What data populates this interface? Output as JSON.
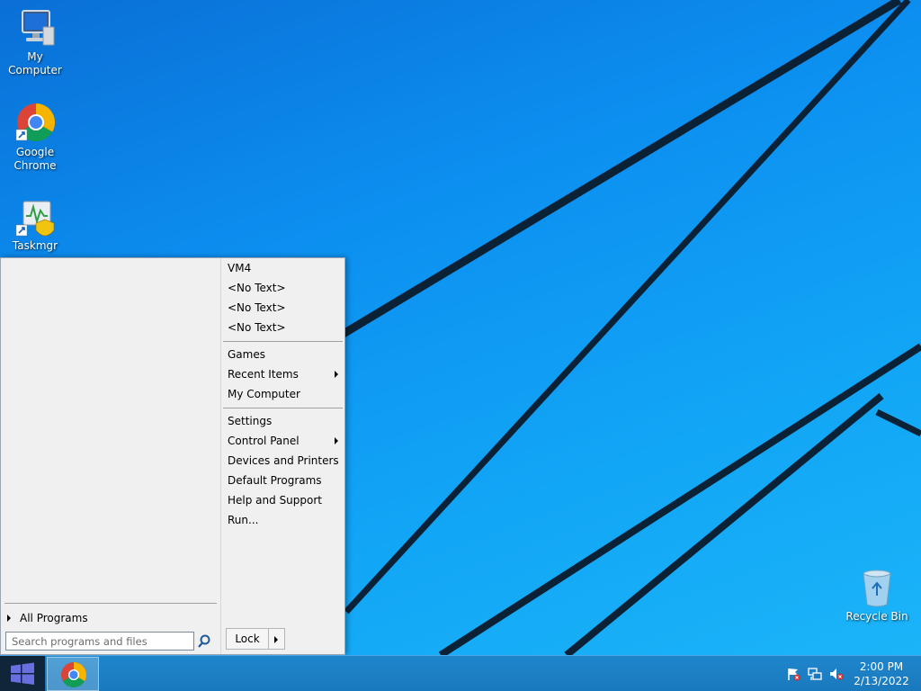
{
  "desktop": {
    "icons": [
      {
        "label": "My Computer",
        "icon": "computer-icon"
      },
      {
        "label": "Google Chrome",
        "icon": "chrome-icon"
      },
      {
        "label": "Taskmgr",
        "icon": "task-manager-icon"
      },
      {
        "label": "Recycle Bin",
        "icon": "recycle-bin-icon"
      }
    ]
  },
  "start_menu": {
    "all_programs_label": "All Programs",
    "search_placeholder": "Search programs and files",
    "right_items": [
      {
        "label": "VM4"
      },
      {
        "label": "<No Text>"
      },
      {
        "label": "<No Text>"
      },
      {
        "label": "<No Text>"
      },
      {
        "label": "Games"
      },
      {
        "label": "Recent Items",
        "submenu": true
      },
      {
        "label": "My Computer"
      },
      {
        "label": "Settings"
      },
      {
        "label": "Control Panel",
        "submenu": true
      },
      {
        "label": "Devices and Printers"
      },
      {
        "label": "Default Programs"
      },
      {
        "label": "Help and Support"
      },
      {
        "label": "Run..."
      }
    ],
    "lock_label": "Lock"
  },
  "taskbar": {
    "pinned": [
      {
        "icon": "chrome-icon"
      }
    ],
    "tray_icons": [
      "action-center-flag-icon",
      "network-icon",
      "volume-muted-icon"
    ],
    "clock": {
      "time": "2:00 PM",
      "date": "2/13/2022"
    }
  },
  "colors": {
    "desktop_blue": "#0c8ff0",
    "taskbar_blue": "#1a79bd",
    "start_button": "#10253a"
  }
}
